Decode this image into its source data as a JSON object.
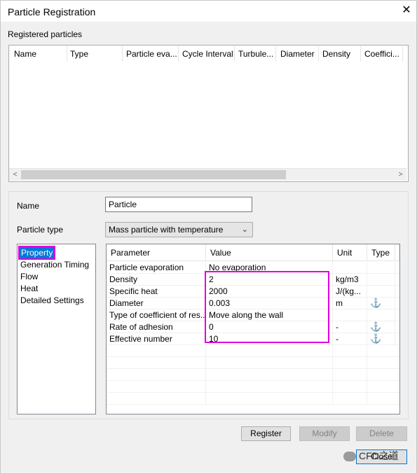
{
  "window": {
    "title": "Particle Registration",
    "close_icon": "close-icon"
  },
  "registered": {
    "label": "Registered particles",
    "columns": [
      "Name",
      "Type",
      "Particle eva...",
      "Cycle Interval",
      "Turbule...",
      "Diameter",
      "Density",
      "Coeffici..."
    ]
  },
  "form": {
    "name_label": "Name",
    "name_value": "Particle",
    "type_label": "Particle type",
    "type_value": "Mass particle with temperature"
  },
  "nav": {
    "items": [
      "Property",
      "Generation Timing",
      "Flow",
      "Heat",
      "Detailed Settings"
    ],
    "selected": "Property"
  },
  "grid": {
    "headers": [
      "Parameter",
      "Value",
      "Unit",
      "Type"
    ],
    "rows": [
      {
        "param": "Particle evaporation",
        "value": "No evaporation",
        "unit": "",
        "type": ""
      },
      {
        "param": "Density",
        "value": "2",
        "unit": "kg/m3",
        "type": ""
      },
      {
        "param": "Specific heat",
        "value": "2000",
        "unit": "J/(kg...",
        "type": ""
      },
      {
        "param": "Diameter",
        "value": "0.003",
        "unit": "m",
        "type": "anchor-icon"
      },
      {
        "param": "Type of coefficient of res...",
        "value": "Move along the wall",
        "unit": "",
        "type": ""
      },
      {
        "param": "Rate of adhesion",
        "value": "0",
        "unit": "-",
        "type": "anchor-icon"
      },
      {
        "param": "Effective number",
        "value": "10",
        "unit": "-",
        "type": "anchor-icon"
      }
    ]
  },
  "buttons": {
    "register": "Register",
    "modify": "Modify",
    "delete": "Delete",
    "close": "Close"
  },
  "watermark": {
    "text": "CFD之道"
  },
  "colors": {
    "selection": "#0078d7",
    "highlight": "#e000e0",
    "anchor": "#1a6fd0"
  }
}
